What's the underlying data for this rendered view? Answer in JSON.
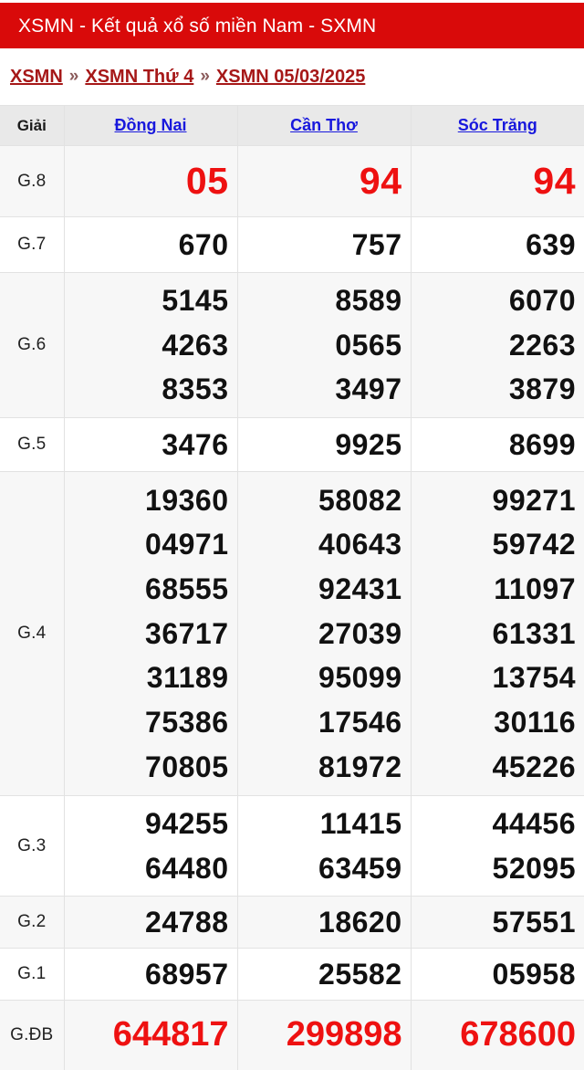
{
  "header": {
    "title": "XSMN - Kết quả xổ số miền Nam - SXMN",
    "background_color": "#d90a0a",
    "text_color": "#ffffff"
  },
  "breadcrumb": {
    "separator": "»",
    "link_color": "#a61818",
    "items": [
      {
        "label": "XSMN"
      },
      {
        "label": "XSMN Thứ 4"
      },
      {
        "label": "XSMN 05/03/2025"
      }
    ]
  },
  "table": {
    "prize_column_header": "Giải",
    "province_link_color": "#1818dd",
    "columns": [
      {
        "label": "Đồng Nai"
      },
      {
        "label": "Cần Thơ"
      },
      {
        "label": "Sóc Trăng"
      }
    ],
    "highlight_color": "#ee1111",
    "rows": [
      {
        "prize": "G.8",
        "style": "special",
        "values": [
          [
            "05"
          ],
          [
            "94"
          ],
          [
            "94"
          ]
        ]
      },
      {
        "prize": "G.7",
        "style": "normal",
        "values": [
          [
            "670"
          ],
          [
            "757"
          ],
          [
            "639"
          ]
        ]
      },
      {
        "prize": "G.6",
        "style": "normal",
        "values": [
          [
            "5145",
            "4263",
            "8353"
          ],
          [
            "8589",
            "0565",
            "3497"
          ],
          [
            "6070",
            "2263",
            "3879"
          ]
        ]
      },
      {
        "prize": "G.5",
        "style": "normal",
        "values": [
          [
            "3476"
          ],
          [
            "9925"
          ],
          [
            "8699"
          ]
        ]
      },
      {
        "prize": "G.4",
        "style": "normal",
        "values": [
          [
            "19360",
            "04971",
            "68555",
            "36717",
            "31189",
            "75386",
            "70805"
          ],
          [
            "58082",
            "40643",
            "92431",
            "27039",
            "95099",
            "17546",
            "81972"
          ],
          [
            "99271",
            "59742",
            "11097",
            "61331",
            "13754",
            "30116",
            "45226"
          ]
        ]
      },
      {
        "prize": "G.3",
        "style": "normal",
        "values": [
          [
            "94255",
            "64480"
          ],
          [
            "11415",
            "63459"
          ],
          [
            "44456",
            "52095"
          ]
        ]
      },
      {
        "prize": "G.2",
        "style": "normal",
        "values": [
          [
            "24788"
          ],
          [
            "18620"
          ],
          [
            "57551"
          ]
        ]
      },
      {
        "prize": "G.1",
        "style": "normal",
        "values": [
          [
            "68957"
          ],
          [
            "25582"
          ],
          [
            "05958"
          ]
        ]
      },
      {
        "prize": "G.ĐB",
        "style": "db",
        "values": [
          [
            "644817"
          ],
          [
            "299898"
          ],
          [
            "678600"
          ]
        ]
      }
    ]
  }
}
